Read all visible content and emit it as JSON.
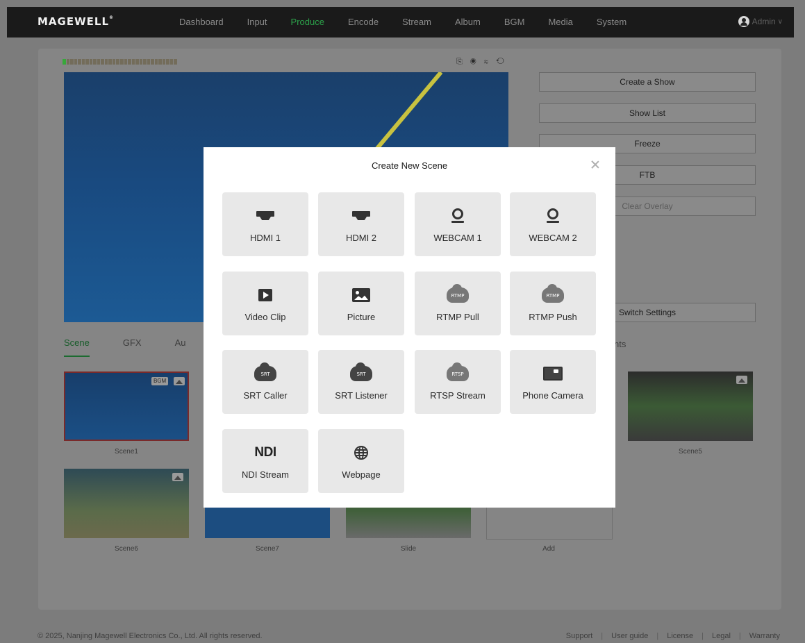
{
  "brand": {
    "logo": "MAGEWELL",
    "reg": "®"
  },
  "nav": {
    "items": [
      {
        "label": "Dashboard"
      },
      {
        "label": "Input"
      },
      {
        "label": "Produce"
      },
      {
        "label": "Encode"
      },
      {
        "label": "Stream"
      },
      {
        "label": "Album"
      },
      {
        "label": "BGM"
      },
      {
        "label": "Media"
      },
      {
        "label": "System"
      }
    ],
    "active": "Produce",
    "user": "Admin",
    "user_chevron": "∨"
  },
  "colors": {
    "accent": "#2ca14a",
    "nav_bg": "#1a1a1a",
    "modal_bg": "#ffffff",
    "tile_bg": "#e8e8e8"
  },
  "status_icons": "⎘ ◉ ≋ ⟲",
  "right_panel": {
    "create_show": "Create a Show",
    "show_list": "Show List",
    "freeze": "Freeze",
    "ftb": "FTB",
    "clear_overlay": "Clear Overlay",
    "switch_settings": "Switch Settings"
  },
  "tabs": {
    "scene": "Scene",
    "gfx": "GFX",
    "partial": "Au",
    "right_partial": "nts"
  },
  "scenes": {
    "scene1": "Scene1",
    "scene5": "Scene5",
    "scene6": "Scene6",
    "scene7": "Scene7",
    "slide": "Slide",
    "add": "Add",
    "bgm_badge": "BGM"
  },
  "modal": {
    "title": "Create New Scene",
    "tiles": [
      {
        "label": "HDMI 1",
        "icon": "hdmi-icon"
      },
      {
        "label": "HDMI 2",
        "icon": "hdmi-icon"
      },
      {
        "label": "WEBCAM 1",
        "icon": "webcam-icon"
      },
      {
        "label": "WEBCAM 2",
        "icon": "webcam-icon"
      },
      {
        "label": "Video Clip",
        "icon": "play-icon"
      },
      {
        "label": "Picture",
        "icon": "picture-icon"
      },
      {
        "label": "RTMP Pull",
        "icon": "rtmp-cloud-icon",
        "badge": "RTMP"
      },
      {
        "label": "RTMP Push",
        "icon": "rtmp-cloud-icon",
        "badge": "RTMP"
      },
      {
        "label": "SRT Caller",
        "icon": "srt-cloud-icon",
        "badge": "SRT"
      },
      {
        "label": "SRT Listener",
        "icon": "srt-cloud-icon",
        "badge": "SRT"
      },
      {
        "label": "RTSP Stream",
        "icon": "rtsp-cloud-icon",
        "badge": "RTSP"
      },
      {
        "label": "Phone Camera",
        "icon": "phone-camera-icon"
      },
      {
        "label": "NDI Stream",
        "icon": "ndi-icon",
        "badge": "NDI"
      },
      {
        "label": "Webpage",
        "icon": "globe-icon"
      }
    ]
  },
  "footer": {
    "copyright": "© 2025, Nanjing Magewell Electronics Co., Ltd. All rights reserved.",
    "links": [
      "Support",
      "User guide",
      "License",
      "Legal",
      "Warranty"
    ],
    "separator": "|"
  }
}
